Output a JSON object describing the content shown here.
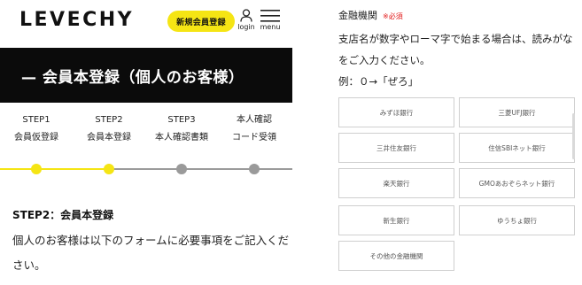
{
  "header": {
    "logo": "LEVECHY",
    "signup_label": "新規会員登録",
    "login_label": "login",
    "menu_label": "menu"
  },
  "banner": {
    "title": "— 会員本登録（個人のお客様）"
  },
  "steps": [
    {
      "num": "STEP1",
      "label": "会員仮登録"
    },
    {
      "num": "STEP2",
      "label": "会員本登録"
    },
    {
      "num": "STEP3",
      "label": "本人確認書類"
    },
    {
      "num": "本人確認",
      "label": "コード受領"
    }
  ],
  "progress": {
    "current_step": 2,
    "total_steps": 4,
    "active_color": "#f5e514",
    "inactive_color": "#9a9a9a"
  },
  "section": {
    "title": "STEP2：会員本登録",
    "description": "個人のお客様は以下のフォームに必要事項をご記入ください。"
  },
  "bank": {
    "label": "金融機関",
    "required": "※必須",
    "note": "支店名が数字やローマ字で始まる場合は、読みがなをご入力ください。",
    "example": "例：０→「ぜろ」",
    "options": [
      "みずほ銀行",
      "三菱UFJ銀行",
      "三井住友銀行",
      "住信SBIネット銀行",
      "楽天銀行",
      "GMOあおぞらネット銀行",
      "新生銀行",
      "ゆうちょ銀行",
      "その他の金融機関"
    ]
  }
}
